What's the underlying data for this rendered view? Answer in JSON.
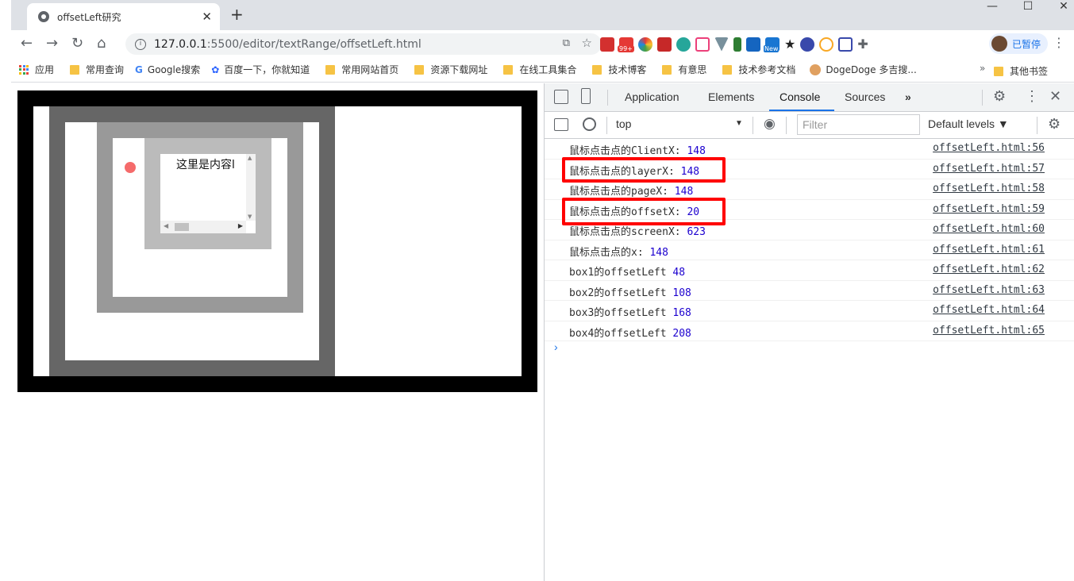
{
  "browser": {
    "tab_title": "offsetLeft研究",
    "tab_close": "✕",
    "new_tab": "+",
    "url_host": "127.0.0.1",
    "url_rest": ":5500/editor/textRange/offsetLeft.html",
    "profile_label": "已暂停",
    "ext_badge_99": "99+",
    "ext_badge_new": "New"
  },
  "bookmarks": [
    {
      "label": "应用",
      "icon": "apps-icon"
    },
    {
      "label": "常用查询",
      "icon": "folder-icon"
    },
    {
      "label": "Google搜索",
      "icon": "google-icon"
    },
    {
      "label": "百度一下，你就知道",
      "icon": "baidu-icon"
    },
    {
      "label": "常用网站首页",
      "icon": "folder-icon"
    },
    {
      "label": "资源下载网址",
      "icon": "folder-icon"
    },
    {
      "label": "在线工具集合",
      "icon": "folder-icon"
    },
    {
      "label": "技术博客",
      "icon": "folder-icon"
    },
    {
      "label": "有意思",
      "icon": "folder-icon"
    },
    {
      "label": "技术参考文档",
      "icon": "folder-icon"
    },
    {
      "label": "DogeDoge 多吉搜...",
      "icon": "doge-icon"
    }
  ],
  "bookmarks_more": "»",
  "bookmarks_other": "其他书签",
  "page": {
    "content_text": "这里是内容l"
  },
  "devtools": {
    "tabs": [
      "Application",
      "Elements",
      "Console",
      "Sources"
    ],
    "active_tab": "Console",
    "context": "top",
    "filter_placeholder": "Filter",
    "levels": "Default levels ▼",
    "logs": [
      {
        "label": "鼠标点击点的ClientX: ",
        "value": "148",
        "src": "offsetLeft.html:56"
      },
      {
        "label": "鼠标点击点的layerX: ",
        "value": "148",
        "src": "offsetLeft.html:57"
      },
      {
        "label": "鼠标点击点的pageX: ",
        "value": "148",
        "src": "offsetLeft.html:58"
      },
      {
        "label": "鼠标点击点的offsetX: ",
        "value": "20",
        "src": "offsetLeft.html:59"
      },
      {
        "label": "鼠标点击点的screenX: ",
        "value": "623",
        "src": "offsetLeft.html:60"
      },
      {
        "label": "鼠标点击点的x: ",
        "value": "148",
        "src": "offsetLeft.html:61"
      },
      {
        "label": "box1的offsetLeft ",
        "value": "48",
        "src": "offsetLeft.html:62"
      },
      {
        "label": "box2的offsetLeft ",
        "value": "108",
        "src": "offsetLeft.html:63"
      },
      {
        "label": "box3的offsetLeft ",
        "value": "168",
        "src": "offsetLeft.html:64"
      },
      {
        "label": "box4的offsetLeft ",
        "value": "208",
        "src": "offsetLeft.html:65"
      }
    ],
    "prompt": "›"
  },
  "colors": {
    "highlight": "#ff0000",
    "dot": "#f56b6b",
    "value_blue": "#1c00cf"
  }
}
